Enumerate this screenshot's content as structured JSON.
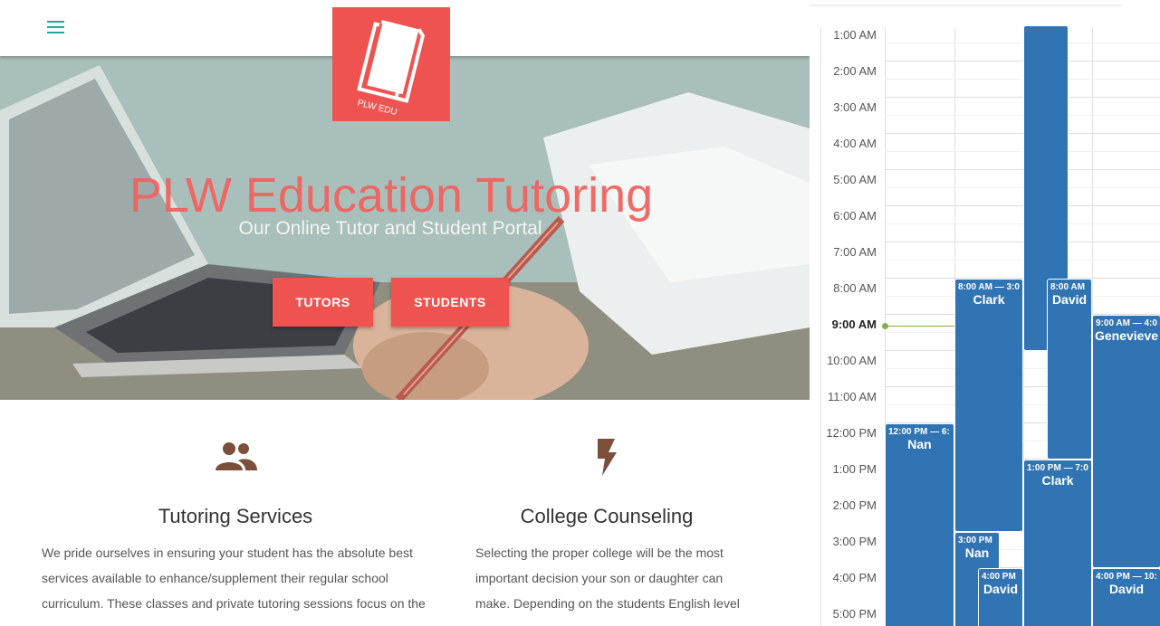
{
  "site": {
    "logo_text": "PLW EDU",
    "hero": {
      "title": "PLW Education Tutoring",
      "subtitle": "Our Online Tutor and Student Portal",
      "buttons": [
        "TUTORS",
        "STUDENTS"
      ]
    },
    "features": [
      {
        "icon": "people-icon",
        "title": "Tutoring Services",
        "lines": [
          "We pride ourselves in ensuring your student has the absolute best",
          "services available to enhance/supplement their regular school",
          "curriculum. These classes and private tutoring sessions focus on the"
        ]
      },
      {
        "icon": "lightning-bolt-icon",
        "title": "College Counseling",
        "lines": [
          "Selecting the proper college will be the most",
          "important decision your son or daughter can",
          "make. Depending on the students English level"
        ]
      }
    ]
  },
  "calendar": {
    "hours": [
      "1:00 AM",
      "2:00 AM",
      "3:00 AM",
      "4:00 AM",
      "5:00 AM",
      "6:00 AM",
      "7:00 AM",
      "8:00 AM",
      "9:00 AM",
      "10:00 AM",
      "11:00 AM",
      "12:00 PM",
      "1:00 PM",
      "2:00 PM",
      "3:00 PM",
      "4:00 PM",
      "5:00 PM"
    ],
    "current_hour": "9:00 AM",
    "events": [
      {
        "time": "",
        "name": ""
      },
      {
        "time": "8:00 AM — 3:0",
        "name": "Clark"
      },
      {
        "time": "8:00 AM",
        "name": "David"
      },
      {
        "time": "9:00 AM — 4:0",
        "name": "Genevieve"
      },
      {
        "time": "12:00 PM — 6:",
        "name": "Nan"
      },
      {
        "time": "1:00 PM — 7:0",
        "name": "Clark"
      },
      {
        "time": "3:00 PM",
        "name": "Nan"
      },
      {
        "time": "4:00 PM",
        "name": "David"
      },
      {
        "time": "4:00 PM — 10:",
        "name": "David"
      }
    ],
    "colors": {
      "event": "#3174b3",
      "now_line": "#7cb342",
      "accent": "#ef5350",
      "menu": "#26a69a"
    }
  }
}
